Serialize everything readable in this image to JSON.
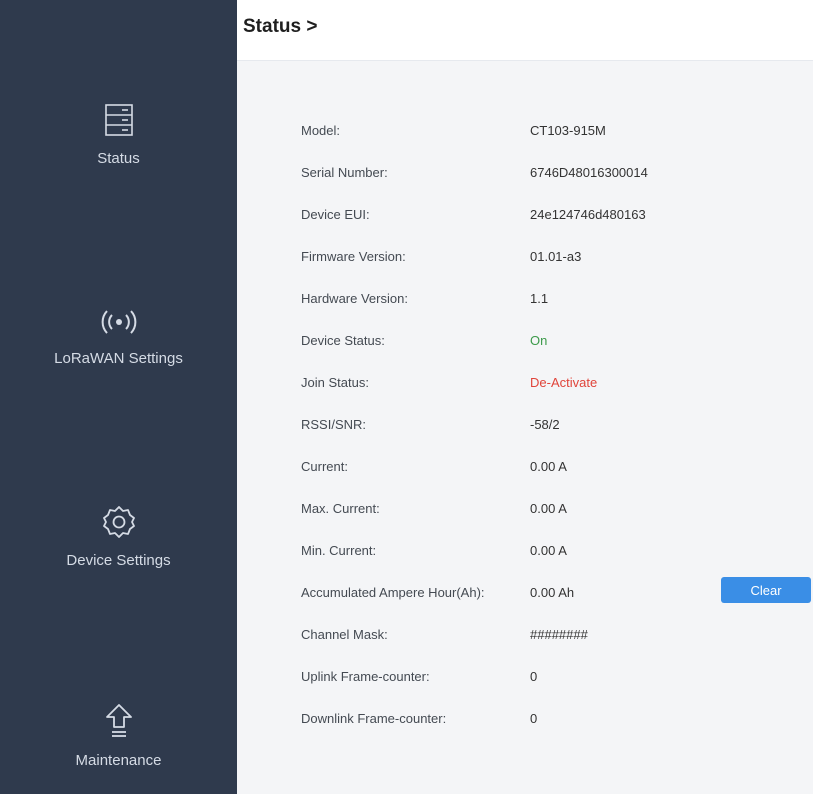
{
  "sidebar": {
    "items": [
      {
        "label": "Status",
        "icon": "server-icon"
      },
      {
        "label": "LoRaWAN Settings",
        "icon": "signal-icon"
      },
      {
        "label": "Device Settings",
        "icon": "gear-icon"
      },
      {
        "label": "Maintenance",
        "icon": "upload-icon"
      }
    ]
  },
  "header": {
    "title": "Status >"
  },
  "status": {
    "rows": [
      {
        "label": "Model:",
        "value": "CT103-915M"
      },
      {
        "label": "Serial Number:",
        "value": "6746D48016300014"
      },
      {
        "label": "Device EUI:",
        "value": "24e124746d480163"
      },
      {
        "label": "Firmware Version:",
        "value": "01.01-a3"
      },
      {
        "label": "Hardware Version:",
        "value": "1.1"
      },
      {
        "label": "Device Status:",
        "value": "On"
      },
      {
        "label": "Join Status:",
        "value": "De-Activate"
      },
      {
        "label": "RSSI/SNR:",
        "value": "-58/2"
      },
      {
        "label": "Current:",
        "value": "0.00 A"
      },
      {
        "label": "Max. Current:",
        "value": "0.00 A"
      },
      {
        "label": "Min. Current:",
        "value": "0.00 A"
      },
      {
        "label": "Accumulated Ampere Hour(Ah):",
        "value": "0.00 Ah"
      },
      {
        "label": "Channel Mask:",
        "value": "########"
      },
      {
        "label": "Uplink Frame-counter:",
        "value": "0"
      },
      {
        "label": "Downlink Frame-counter:",
        "value": "0"
      }
    ],
    "clear_label": "Clear"
  },
  "colors": {
    "sidebar_bg": "#2f3a4d",
    "status_on": "#3c9a4a",
    "status_deactivate": "#e0443a",
    "button_bg": "#3a8ee6"
  }
}
